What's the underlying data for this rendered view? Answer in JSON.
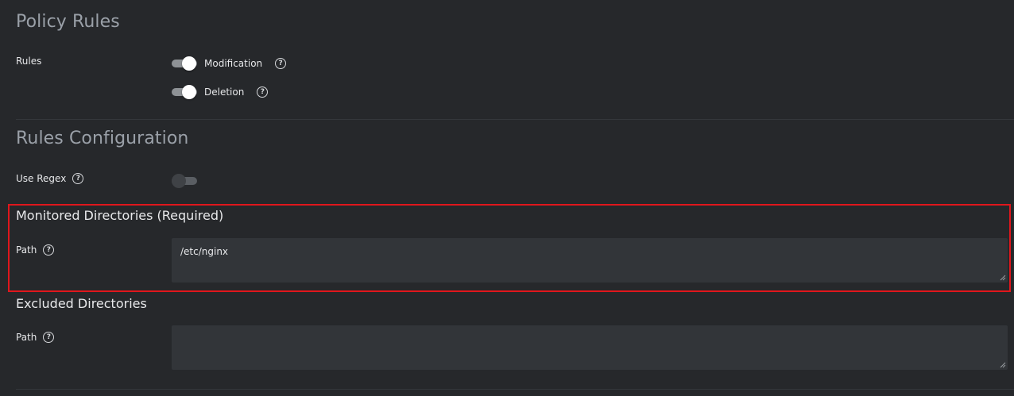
{
  "policy_rules": {
    "title": "Policy Rules",
    "rules_label": "Rules",
    "toggles": [
      {
        "label": "Modification",
        "state": "on"
      },
      {
        "label": "Deletion",
        "state": "on"
      }
    ]
  },
  "rules_configuration": {
    "title": "Rules Configuration",
    "use_regex_label": "Use Regex",
    "use_regex_state": "off"
  },
  "monitored_directories": {
    "title": "Monitored Directories (Required)",
    "path_label": "Path",
    "path_value": "/etc/nginx"
  },
  "excluded_directories": {
    "title": "Excluded Directories",
    "path_label": "Path",
    "path_value": ""
  },
  "colors": {
    "background": "#26282b",
    "input_background": "#323539",
    "highlight": "#e0161c",
    "toggle_on_track": "#8e9296",
    "section_title": "#9aa0a8"
  },
  "icons": {
    "help": "question-circle-icon",
    "resize": "resize-grip-icon"
  }
}
